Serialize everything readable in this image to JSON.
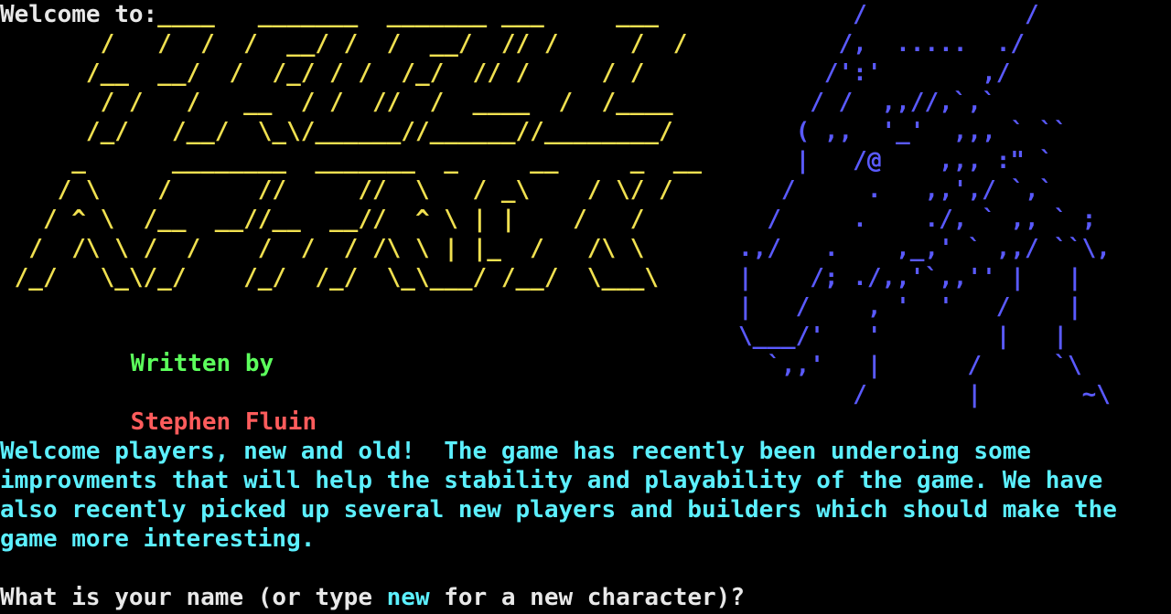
{
  "terminal": {
    "welcome_label": "Welcome to:",
    "title_art": "           ____   _______  _______ ___     ___\n       /   /  /  /  __/ /  /  __/  // /     /  /\n      /__  __/  /  /_/ / /  /_/  // /     / /\n       / /   /   __  / /  //  /  ____  /  /____\n      /_/   /__/  \\_\\/______//______//________/\n     _      ________  _______  _     __     _  __\n    / \\    /      //     //  \\   / _\\    / \\/ /\n   / ^ \\  /__  __//__  __//  ^ \\ | |    /   /\n  /  /\\ \\ /  /    /  /  / /\\ \\ | |_  /   /\\ \\\n /_/   \\_\\/_/    /_/  /_/  \\_\\___/ /__/  \\___\\",
    "dragon_art": "           /           /\n          /,  .....  ./\n         /':'       ,/\n        / /  ,,//,`,`\n       ( ,,  '_'  ,,, ` ``\n       |   /@    ,,, :\" `\n      /     .   ,,',/ `,`\n     /     .    ./, ` ,, ` ;\n   .,/   .    ,_,' ` ,,/ ``\\,\n   |    /; ./,,'`,,'' |   |\n   |   /    , '  '   /    |\n   \\___/'   '        |   |\n     `,,'   |      /     `\\\n           /       |       ~\\",
    "byline": {
      "written_by": "Written by",
      "author": "Stephen Fluin"
    },
    "intro_lines": [
      "Welcome players, new and old!  The game has recently been underoing some",
      "improvments that will help the stability and playability of the game. We have",
      "also recently picked up several new players and builders which should make the",
      "game more interesting."
    ],
    "prompt": {
      "before": "What is your name (or type ",
      "keyword": "new",
      "after": " for a new character)?"
    },
    "colors": {
      "background": "#000000",
      "title_yellow": "#f0e050",
      "dragon_blue": "#5a5aff",
      "written_green": "#5cff5c",
      "author_red": "#ff5c5c",
      "intro_cyan": "#5cf0ff",
      "prompt_white": "#e8e8e8"
    }
  }
}
